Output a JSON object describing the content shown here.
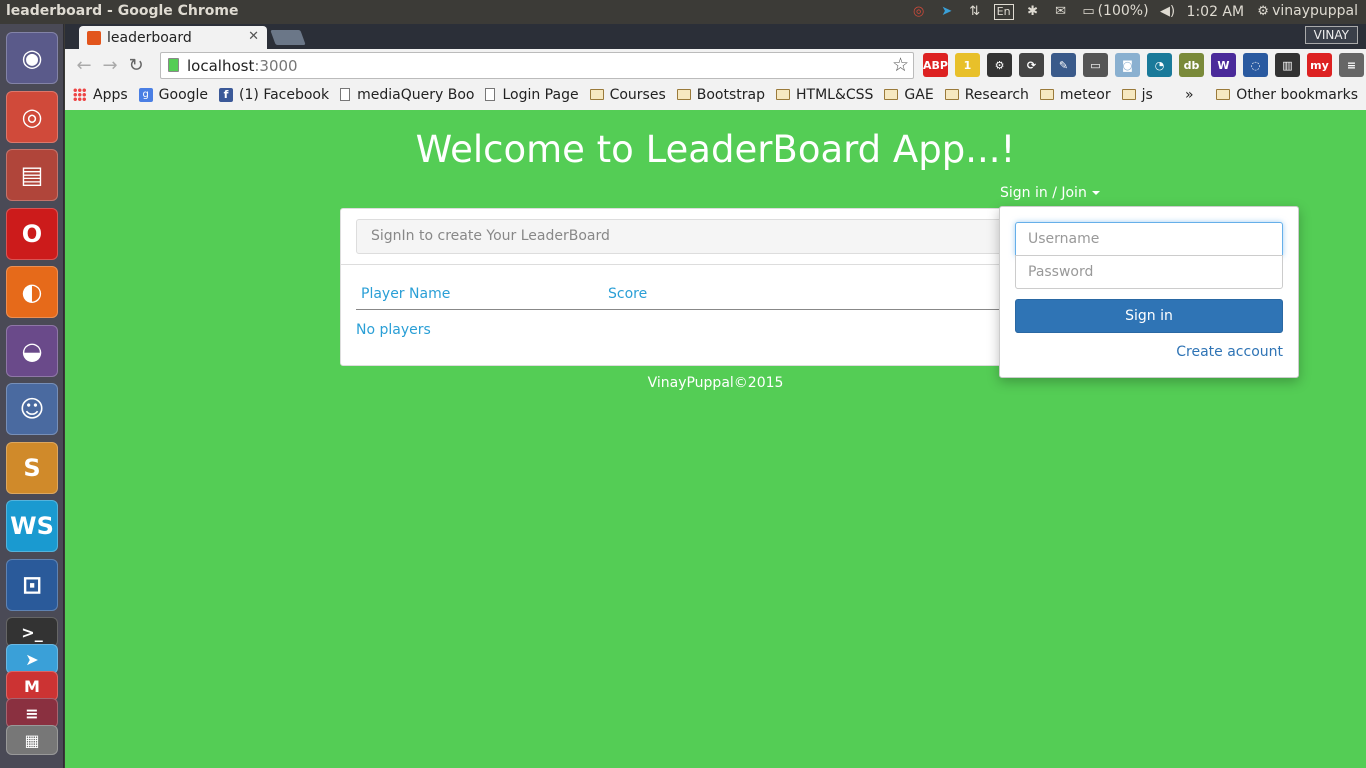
{
  "os": {
    "window_title": "leaderboard - Google Chrome",
    "battery": "(100%)",
    "clock": "1:02 AM",
    "user": "vinaypuppal",
    "keyboard_layout": "En"
  },
  "launcher": {
    "items": [
      {
        "name": "ubuntu-dash-icon",
        "glyph": "◉",
        "color": "#5a5a8a"
      },
      {
        "name": "chrome-icon",
        "glyph": "◎",
        "color": "#d04a3a"
      },
      {
        "name": "files-icon",
        "glyph": "▤",
        "color": "#b0453a"
      },
      {
        "name": "opera-icon",
        "glyph": "O",
        "color": "#cc1b1b"
      },
      {
        "name": "firefox-icon",
        "glyph": "◐",
        "color": "#e66a1a"
      },
      {
        "name": "tor-browser-icon",
        "glyph": "◒",
        "color": "#6a4a8a"
      },
      {
        "name": "pidgin-icon",
        "glyph": "☺",
        "color": "#4a6aa0"
      },
      {
        "name": "sublime-text-icon",
        "glyph": "S",
        "color": "#d08a2a"
      },
      {
        "name": "webstorm-icon",
        "glyph": "WS",
        "color": "#1a9ad0"
      },
      {
        "name": "app-icon",
        "glyph": "⊡",
        "color": "#2a5a9a"
      },
      {
        "name": "terminal-icon",
        "glyph": ">_",
        "color": "#333333"
      },
      {
        "name": "telegram-icon",
        "glyph": "➤",
        "color": "#3aa0d8"
      },
      {
        "name": "gmail-icon",
        "glyph": "M",
        "color": "#cc3333"
      },
      {
        "name": "stacked-app-icon",
        "glyph": "≡",
        "color": "#8a3040"
      },
      {
        "name": "workspace-icon",
        "glyph": "▦",
        "color": "#777777"
      }
    ]
  },
  "browser": {
    "tab_title": "leaderboard",
    "profile": "VINAY",
    "url_host": "localhost",
    "url_port": ":3000",
    "extensions": [
      {
        "name": "adblock-icon",
        "label": "ABP",
        "color": "#d22"
      },
      {
        "name": "extension-badge-icon",
        "label": "1",
        "color": "#e8c02a"
      },
      {
        "name": "gear-extension-icon",
        "label": "⚙",
        "color": "#333"
      },
      {
        "name": "sync-extension-icon",
        "label": "⟳",
        "color": "#444"
      },
      {
        "name": "eyedropper-icon",
        "label": "✎",
        "color": "#3a5a8a"
      },
      {
        "name": "scanner-icon",
        "label": "▭",
        "color": "#555"
      },
      {
        "name": "camera-icon",
        "label": "◙",
        "color": "#8ab0d0"
      },
      {
        "name": "feed-extension-icon",
        "label": "◔",
        "color": "#1a7a9a"
      },
      {
        "name": "db-extension-icon",
        "label": "db",
        "color": "#7a8a3a"
      },
      {
        "name": "w-extension-icon",
        "label": "W",
        "color": "#4a2a9a"
      },
      {
        "name": "chat-extension-icon",
        "label": "◌",
        "color": "#2a5aa0"
      },
      {
        "name": "film-extension-icon",
        "label": "▥",
        "color": "#333"
      },
      {
        "name": "my-extension-icon",
        "label": "my",
        "color": "#d22"
      },
      {
        "name": "menu-icon",
        "label": "≡",
        "color": "#666"
      }
    ],
    "bookmarks": [
      {
        "label": "Apps",
        "kind": "apps"
      },
      {
        "label": "Google",
        "kind": "google"
      },
      {
        "label": "(1) Facebook",
        "kind": "facebook"
      },
      {
        "label": "mediaQuery Boo",
        "kind": "doc"
      },
      {
        "label": "Login Page",
        "kind": "doc"
      },
      {
        "label": "Courses",
        "kind": "folder"
      },
      {
        "label": "Bootstrap",
        "kind": "folder"
      },
      {
        "label": "HTML&CSS",
        "kind": "folder"
      },
      {
        "label": "GAE",
        "kind": "folder"
      },
      {
        "label": "Research",
        "kind": "folder"
      },
      {
        "label": "meteor",
        "kind": "folder"
      },
      {
        "label": "js",
        "kind": "folder"
      }
    ],
    "bookmarks_more": "»",
    "other_bookmarks": "Other bookmarks"
  },
  "app": {
    "heading": "Welcome to LeaderBoard App...!",
    "signin_toggle": "Sign in / Join",
    "hint": "SignIn to create Your LeaderBoard",
    "columns": [
      "Player Name",
      "Score"
    ],
    "empty_text": "No players",
    "footer": "VinayPuppal©2015",
    "login": {
      "username_placeholder": "Username",
      "password_placeholder": "Password",
      "signin_button": "Sign in",
      "create_account": "Create account"
    }
  }
}
